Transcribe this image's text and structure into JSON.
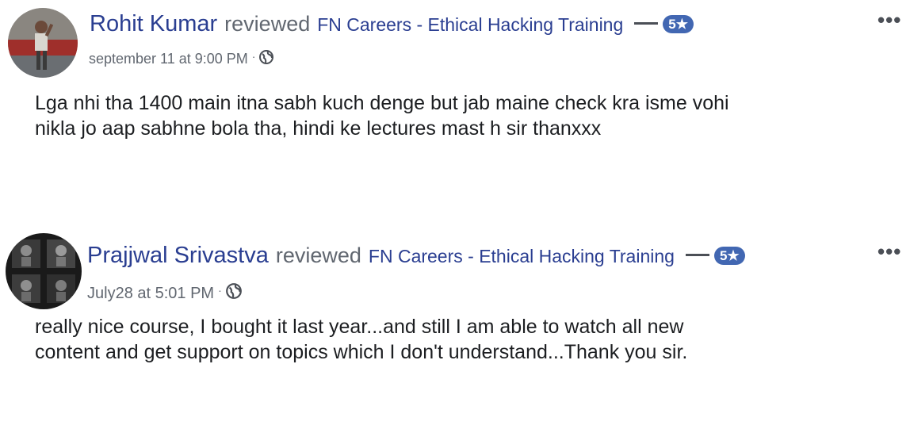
{
  "reviews": [
    {
      "author": "Rohit Kumar",
      "verb": "reviewed",
      "page": "FN Careers - Ethical Hacking Training",
      "rating": "5★",
      "timestamp": "september 11 at 9:00 PM",
      "separator": "·",
      "privacy_icon": "globe-icon",
      "more_icon": "•••",
      "body_lines": [
        "Lga nhi tha 1400 main itna sabh kuch denge but jab maine check kra isme vohi",
        "nikla jo aap sabhne bola tha, hindi ke lectures mast h sir thanxxx"
      ]
    },
    {
      "author": "Prajjwal Srivastva",
      "verb": "reviewed",
      "page": "FN Careers - Ethical Hacking Training",
      "rating": "5★",
      "timestamp": "July28 at 5:01 PM",
      "separator": "·",
      "privacy_icon": "globe-icon",
      "more_icon": "•••",
      "body_lines": [
        "really nice course, I bought it last year...and still I am able to watch all new",
        "content and get support on topics which I don't understand...Thank you sir."
      ]
    }
  ],
  "colors": {
    "link": "#2a3e91",
    "muted": "#616770",
    "badge": "#4267b2",
    "text": "#1c1e21"
  }
}
